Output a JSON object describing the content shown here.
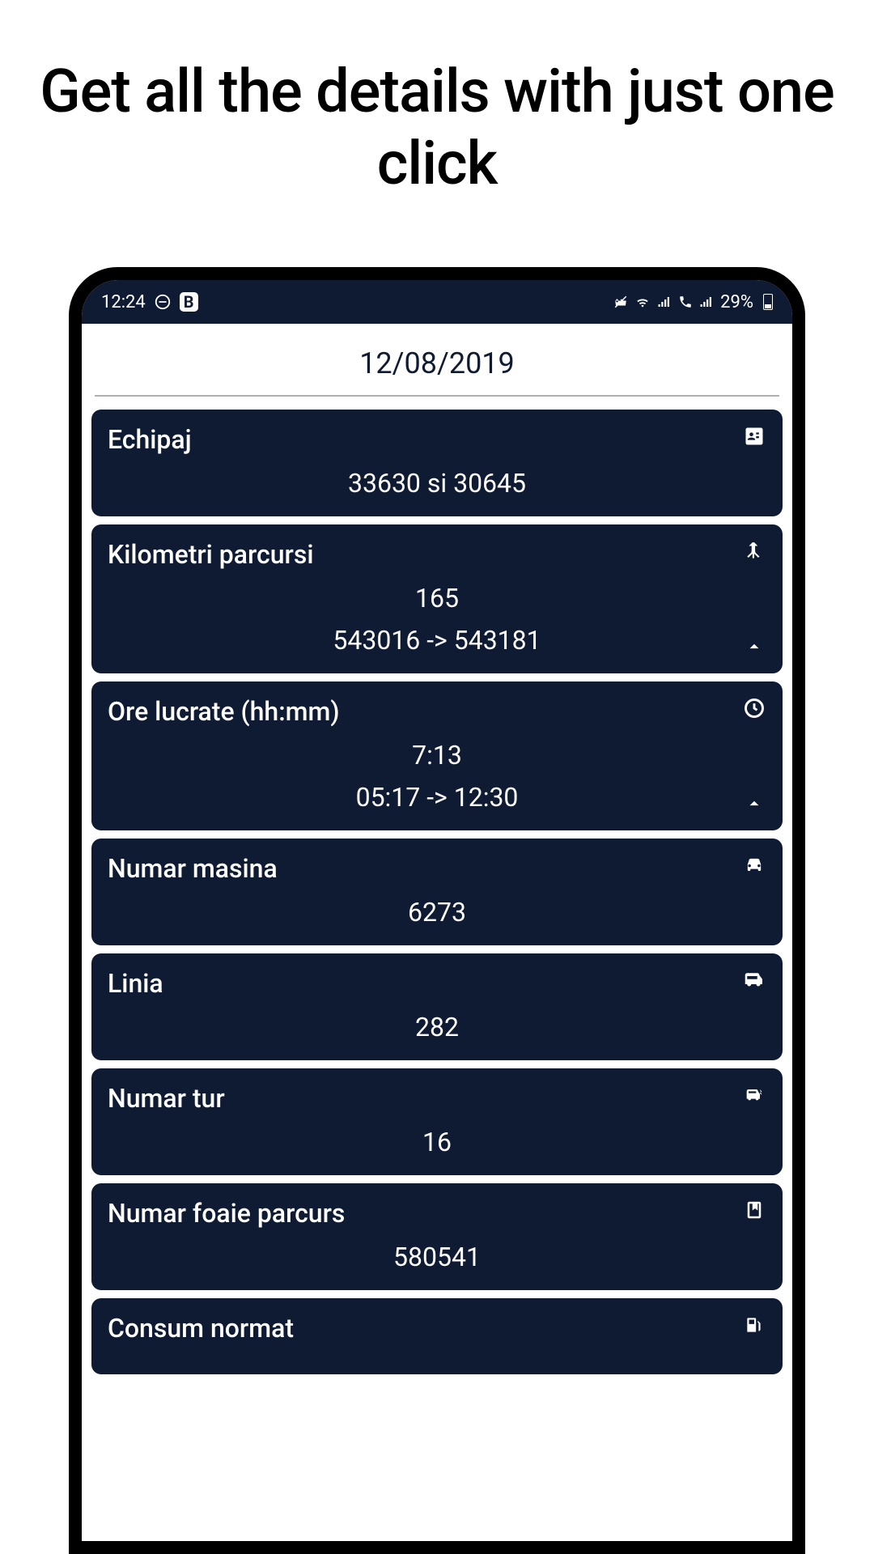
{
  "promo": {
    "text": "Get all the details with just one click"
  },
  "statusBar": {
    "time": "12:24",
    "battery": "29%"
  },
  "header": {
    "date": "12/08/2019"
  },
  "cards": [
    {
      "title": "Echipaj",
      "value": "33630 si 30645"
    },
    {
      "title": "Kilometri parcursi",
      "value": "165",
      "subvalue": "543016 -> 543181"
    },
    {
      "title": "Ore lucrate (hh:mm)",
      "value": "7:13",
      "subvalue": "05:17 -> 12:30"
    },
    {
      "title": "Numar masina",
      "value": "6273"
    },
    {
      "title": "Linia",
      "value": "282"
    },
    {
      "title": "Numar tur",
      "value": "16"
    },
    {
      "title": "Numar foaie parcurs",
      "value": "580541"
    },
    {
      "title": "Consum normat",
      "value": ""
    }
  ]
}
